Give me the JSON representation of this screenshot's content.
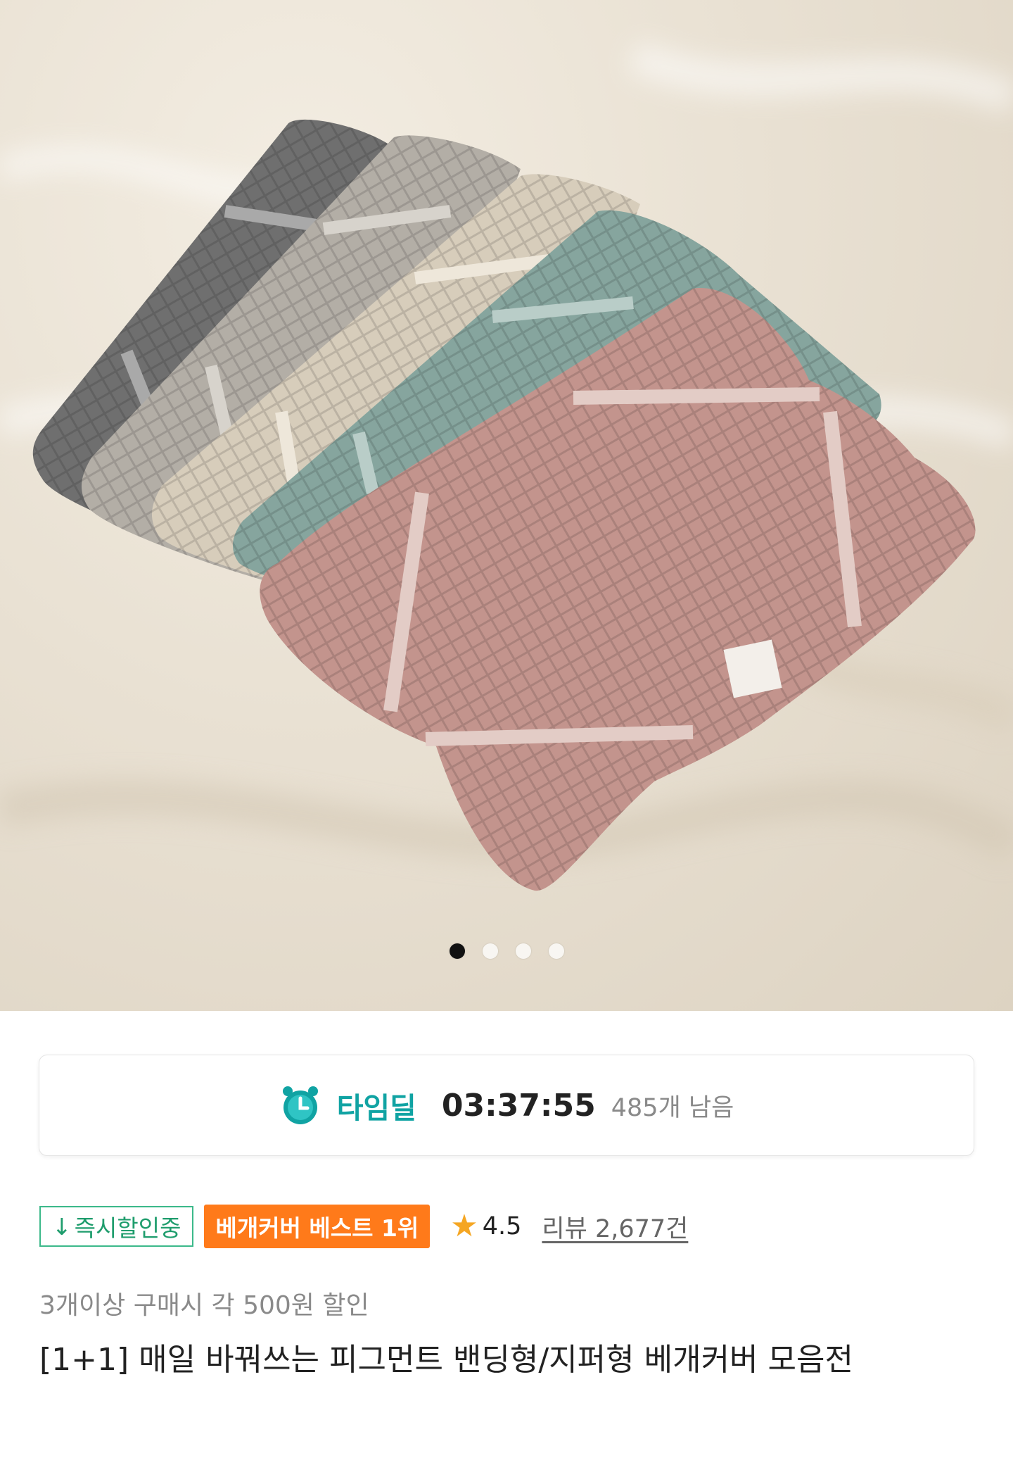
{
  "gallery": {
    "slide_count": 4,
    "active_index": 0,
    "image_alt": "pillow covers in grey, beige, mint and pink"
  },
  "time_deal": {
    "label": "타임딜",
    "countdown": "03:37:55",
    "remaining": "485개 남음",
    "icon": "alarm-clock-icon",
    "accent_color": "#10a3a3"
  },
  "badges": {
    "instant_discount": "즉시할인중",
    "instant_discount_icon": "down-arrow-icon",
    "best": "베개커버 베스트 1위",
    "best_color": "#ff7a1a"
  },
  "rating": {
    "value": "4.5",
    "review_label": "리뷰 2,677건"
  },
  "promo_text": "3개이상 구매시 각 500원 할인",
  "product_title": "[1+1] 매일 바꿔쓰는 피그먼트 밴딩형/지퍼형 베개커버 모음전"
}
